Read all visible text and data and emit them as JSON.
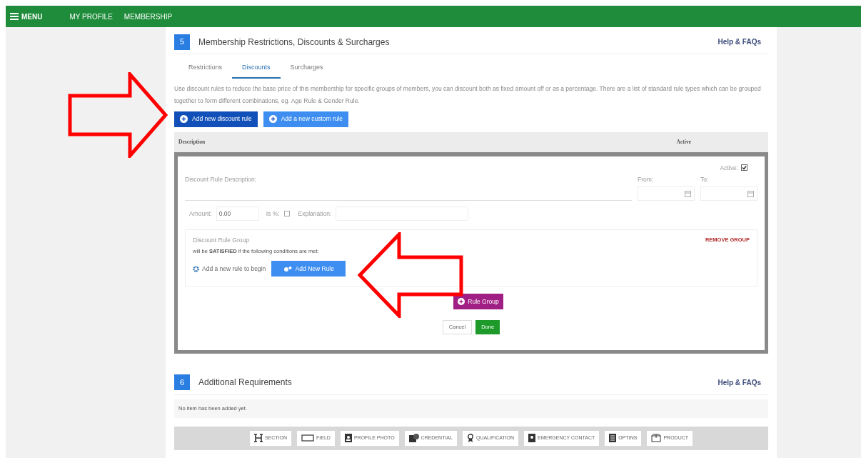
{
  "nav": {
    "menu": "MENU",
    "links": [
      "MY PROFILE",
      "MEMBERSHIP"
    ]
  },
  "section5": {
    "number": "5",
    "title": "Membership Restrictions, Discounts & Surcharges",
    "help": "Help & FAQs",
    "tabs": [
      {
        "label": "Restrictions",
        "selected": false
      },
      {
        "label": "Discounts",
        "selected": true
      },
      {
        "label": "Surcharges",
        "selected": false
      }
    ],
    "intro": "Use discount rules to reduce the base price of this membership for specific groups of members, you can discount both as fixed amount off or as a percentage. There are a list of standard rule types which can be grouped together to form different combinations, eg. Age Rule & Gender Rule.",
    "buttons": [
      {
        "label": "Add new discount rule",
        "kind": "primary"
      },
      {
        "label": "Add a new custom rule",
        "kind": "secondary"
      }
    ],
    "table": {
      "columns": [
        "Description",
        "Active"
      ]
    },
    "editor": {
      "active_label": "Active:",
      "active": true,
      "description_label": "Discount Rule Description:",
      "from_label": "From:",
      "to_label": "To:",
      "amount_label": "Amount:",
      "amount": "0.00",
      "percent_label": "Is %:",
      "percent": false,
      "explanation_label": "Explanation:",
      "group": {
        "title": "Discount Rule Group",
        "condition": "will be **SATISFIED** if the following conditions are met:",
        "remove": "REMOVE GROUP",
        "hint": "Add a new rule to begin",
        "add_rule": "Add New Rule"
      },
      "rule_group": "Rule Group",
      "cancel": "Cancel",
      "done": "Done"
    }
  },
  "section6": {
    "number": "6",
    "title": "Additional Requirements",
    "help": "Help & FAQs",
    "empty": "No item has been added yet.",
    "toolbar": [
      {
        "label": "SECTION",
        "kind": "section"
      },
      {
        "label": "FIELD",
        "kind": "field"
      },
      {
        "label": "PROFILE PHOTO",
        "kind": "photo"
      },
      {
        "label": "CREDENTIAL",
        "kind": "credential"
      },
      {
        "label": "QUALIFICATION",
        "kind": "qualification"
      },
      {
        "label": "EMERGENCY CONTACT",
        "kind": "contact"
      },
      {
        "label": "OPTINS",
        "kind": "optins"
      },
      {
        "label": "PRODUCT",
        "kind": "product"
      }
    ]
  }
}
